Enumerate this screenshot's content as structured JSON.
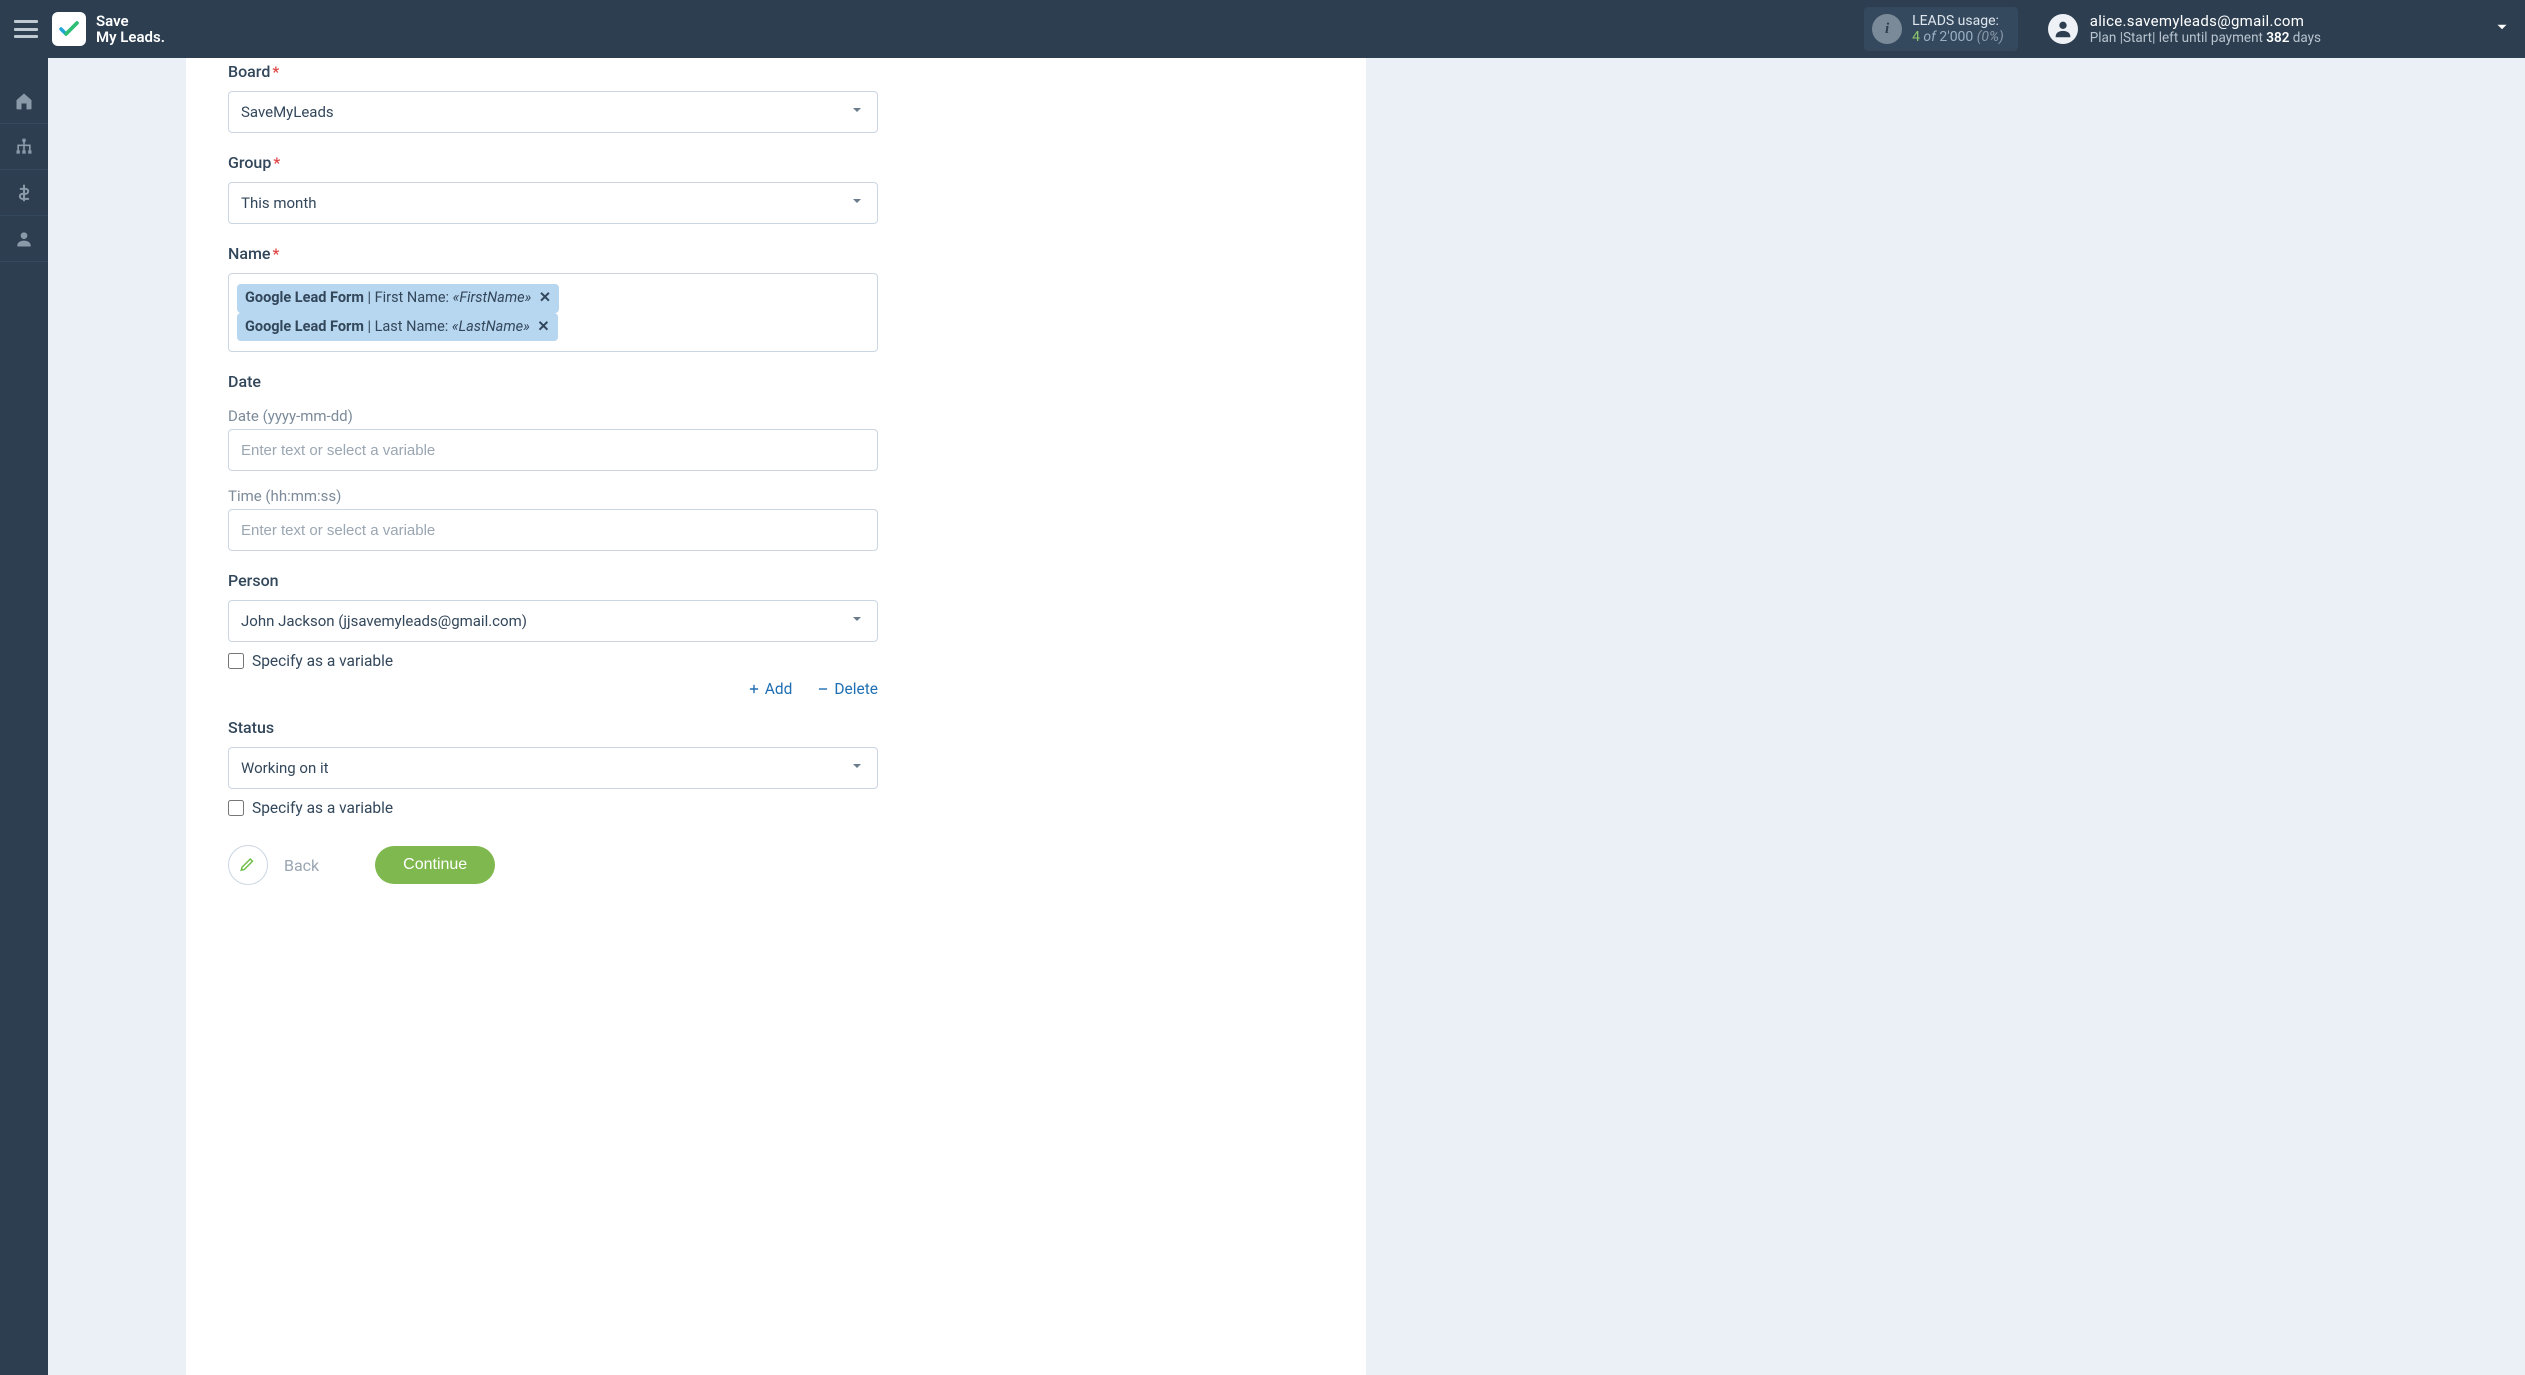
{
  "brand": {
    "line1": "Save",
    "line2": "My Leads."
  },
  "usage": {
    "label": "LEADS usage:",
    "current": "4",
    "of": "of",
    "total": "2'000",
    "percent": "(0%)"
  },
  "account": {
    "email": "alice.savemyleads@gmail.com",
    "plan_prefix": "Plan |Start| left until payment ",
    "days": "382",
    "days_suffix": " days"
  },
  "form": {
    "board": {
      "label": "Board",
      "value": "SaveMyLeads"
    },
    "group": {
      "label": "Group",
      "value": "This month"
    },
    "name": {
      "label": "Name",
      "tokens": [
        {
          "source": "Google Lead Form",
          "label": "First Name:",
          "var": "«FirstName»"
        },
        {
          "source": "Google Lead Form",
          "label": "Last Name:",
          "var": "«LastName»"
        }
      ]
    },
    "date": {
      "label": "Date",
      "sub_date": "Date (yyyy-mm-dd)",
      "ph_date": "Enter text or select a variable",
      "sub_time": "Time (hh:mm:ss)",
      "ph_time": "Enter text or select a variable"
    },
    "person": {
      "label": "Person",
      "value": "John Jackson (jjsavemyleads@gmail.com)",
      "specify": "Specify as a variable"
    },
    "actions": {
      "add": "Add",
      "delete": "Delete"
    },
    "status": {
      "label": "Status",
      "value": "Working on it",
      "specify": "Specify as a variable"
    },
    "footer": {
      "back": "Back",
      "continue": "Continue"
    }
  }
}
